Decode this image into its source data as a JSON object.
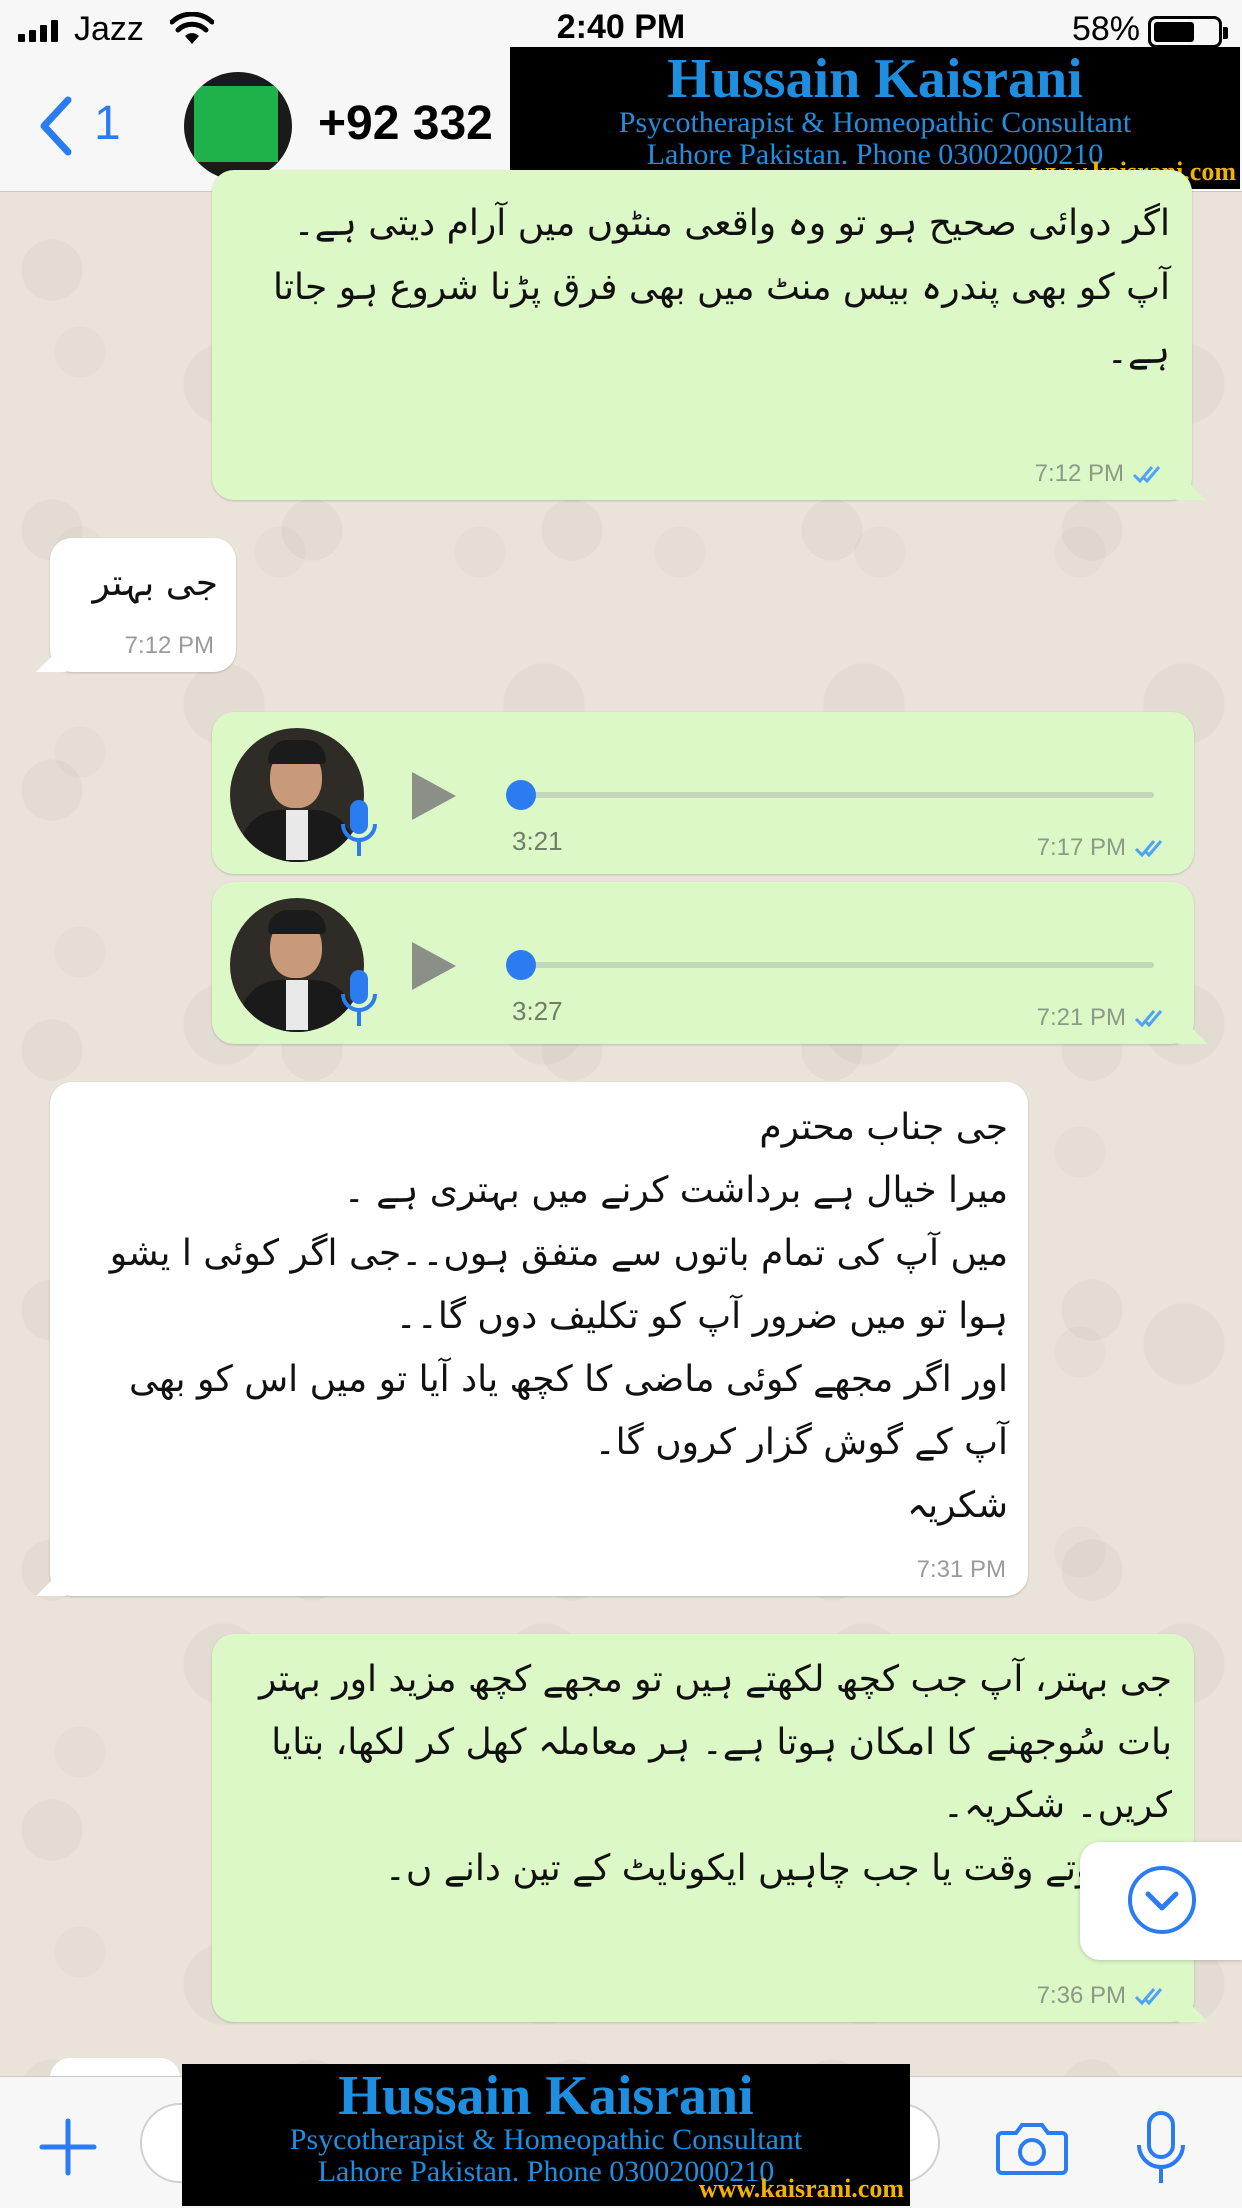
{
  "status_bar": {
    "carrier": "Jazz",
    "time": "2:40 PM",
    "battery": "58%"
  },
  "header": {
    "back_count": "1",
    "contact_name": "+92 332"
  },
  "watermark": {
    "name": "Hussain Kaisrani",
    "title": "Psycotherapist & Homeopathic Consultant",
    "location_phone": "Lahore Pakistan. Phone 03002000210",
    "url": "www.kaisrani.com"
  },
  "messages": [
    {
      "direction": "out",
      "type": "text",
      "text": "اگر دوائی صحیح ہو تو وہ واقعی منٹوں میں آرام دیتی ہے۔\nآپ کو بھی پندرہ بیس منٹ میں بھی فرق پڑنا شروع ہو جاتا ہے۔",
      "time": "7:12 PM",
      "status": "read"
    },
    {
      "direction": "in",
      "type": "text",
      "text": "جی بہتر",
      "time": "7:12 PM"
    },
    {
      "direction": "out",
      "type": "voice",
      "duration": "3:21",
      "progress": 0,
      "time": "7:17 PM",
      "status": "read"
    },
    {
      "direction": "out",
      "type": "voice",
      "duration": "3:27",
      "progress": 0,
      "time": "7:21 PM",
      "status": "read"
    },
    {
      "direction": "in",
      "type": "text",
      "text": "جی جناب محترم\nمیرا خیال ہے برداشت کرنے میں بہتری ہے ۔\nمیں آپ کی تمام باتوں سے متفق ہوں۔۔جی اگر کوئی ا یشو ہوا تو میں ضرور آپ کو تکلیف دوں گا۔۔\nاور اگر مجھے کوئی ماضی کا کچھ یاد آیا تو میں اس کو بھی آپ کے گوش گزار کروں گا۔\nشکریہ",
      "time": "7:31 PM"
    },
    {
      "direction": "out",
      "type": "text",
      "text": "جی بہتر، آپ جب کچھ لکھتے ہیں تو مجھے کچھ مزید اور بہتر بات سُوجھنے کا امکان ہوتا ہے۔ ہر معاملہ کھل کر لکھا، بتایا کریں۔ شکریہ۔\nکو سوتے وقت یا جب چاہیں ایکونایٹ کے تین دانے ں۔",
      "time": "7:36 PM",
      "status": "read"
    }
  ],
  "icons": {
    "back": "chevron-left-icon",
    "play": "play-icon",
    "mic": "microphone-icon",
    "scroll": "chevron-down-circle-icon",
    "plus": "plus-icon",
    "camera": "camera-icon"
  },
  "colors": {
    "accent": "#2b7cf0",
    "outgoing_bubble": "#dcf8c6",
    "incoming_bubble": "#ffffff",
    "watermark_text": "#1e8fe0",
    "watermark_url": "#f2b300"
  }
}
